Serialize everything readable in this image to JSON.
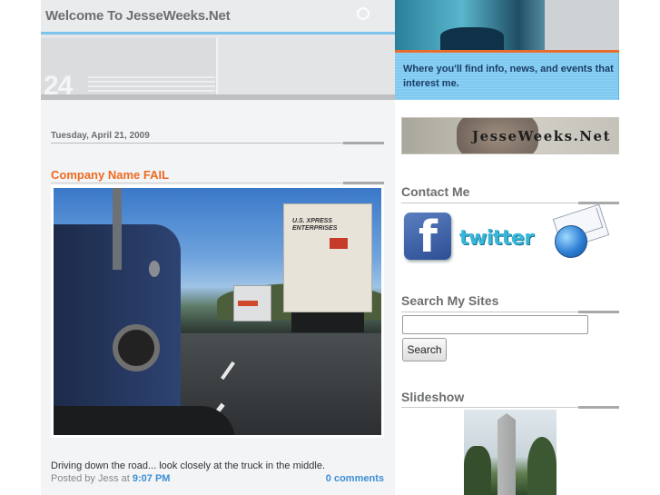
{
  "header": {
    "title": "Welcome To JesseWeeks.Net",
    "tagline": "Where you'll find info, news, and events that interest me.",
    "decor_number": "24"
  },
  "post": {
    "date": "Tuesday, April 21, 2009",
    "title": "Company Name FAIL",
    "body": "Driving down the road... look closely at the truck in the middle.",
    "posted_by_prefix": "Posted by Jess at",
    "time": "9:07 PM",
    "comments": "0 comments",
    "photo_text": "U.S. XPRESS\nENTERPRISES"
  },
  "sidebar": {
    "banner_text": "JesseWeeks.Net",
    "contact_title": "Contact Me",
    "twitter_label": "twitter",
    "facebook_label": "f",
    "search_title": "Search My Sites",
    "search_placeholder": "",
    "search_button": "Search",
    "slideshow_title": "Slideshow"
  },
  "colors": {
    "accent_orange": "#ee6a22",
    "link_blue": "#3d8fd6",
    "tagline_bg": "#8ed3f5"
  }
}
